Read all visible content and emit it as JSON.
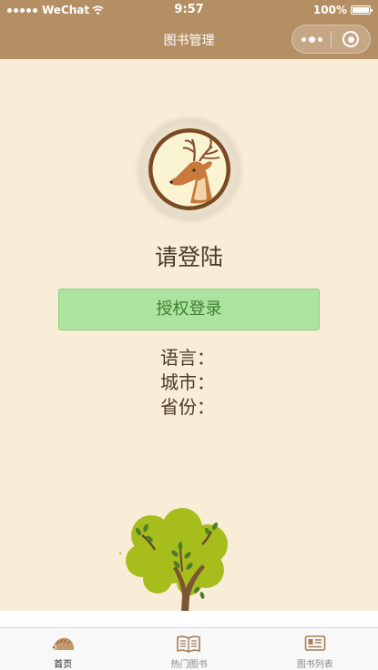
{
  "status_bar": {
    "carrier": "WeChat",
    "time": "9:57",
    "battery": "100%"
  },
  "nav": {
    "title": "图书管理"
  },
  "login": {
    "title": "请登陆",
    "auth_button_label": "授权登录"
  },
  "info": {
    "language_label": "语言：",
    "city_label": "城市：",
    "province_label": "省份："
  },
  "tabs": [
    {
      "label": "首页",
      "icon": "hedgehog-icon",
      "active": true
    },
    {
      "label": "热门图书",
      "icon": "open-book-icon",
      "active": false
    },
    {
      "label": "图书列表",
      "icon": "book-list-icon",
      "active": false
    }
  ],
  "colors": {
    "nav_background": "#b58f64",
    "page_background": "#faedd8",
    "button_background": "#ace3a0",
    "button_text": "#3e7e30"
  }
}
